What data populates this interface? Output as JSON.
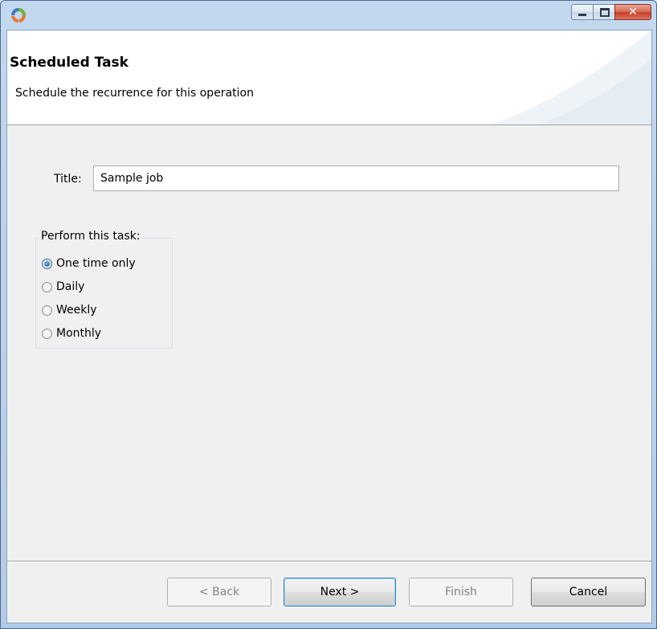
{
  "window": {
    "title": "",
    "accent_color": "#4d6a8c"
  },
  "banner": {
    "title": "Scheduled Task",
    "subtitle": "Schedule the recurrence for this operation"
  },
  "form": {
    "title_label": "Title:",
    "title_value": "Sample job"
  },
  "recurrence": {
    "legend": "Perform this task:",
    "options": [
      {
        "label": "One time only",
        "checked": true
      },
      {
        "label": "Daily",
        "checked": false
      },
      {
        "label": "Weekly",
        "checked": false
      },
      {
        "label": "Monthly",
        "checked": false
      }
    ]
  },
  "buttons": {
    "back": "< Back",
    "next": "Next >",
    "finish": "Finish",
    "cancel": "Cancel"
  }
}
